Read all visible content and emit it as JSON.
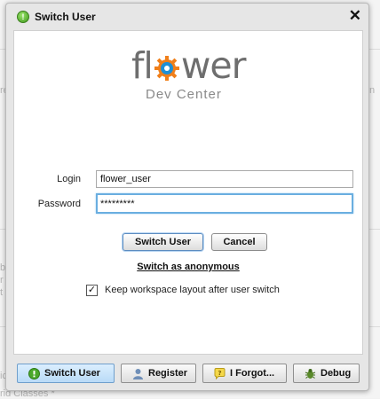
{
  "background": {
    "texts": [
      "re",
      "n",
      "b",
      "r",
      "t",
      "ic",
      "rid Classes *"
    ]
  },
  "dialog": {
    "title": "Switch User",
    "title_icon": "flower-app-icon",
    "close_glyph": "✕"
  },
  "logo": {
    "word": "flower",
    "subtitle": "Dev Center"
  },
  "form": {
    "login_label": "Login",
    "login_value": "flower_user",
    "password_label": "Password",
    "password_value": "*********",
    "switch_button": "Switch User",
    "cancel_button": "Cancel",
    "anonymous_link": "Switch as anonymous",
    "keep_layout_label": "Keep workspace layout after user switch",
    "keep_layout_checked": true
  },
  "footer": {
    "tabs": [
      {
        "label": "Switch User",
        "icon": "switch-user-icon",
        "active": true
      },
      {
        "label": "Register",
        "icon": "user-icon",
        "active": false
      },
      {
        "label": "I Forgot...",
        "icon": "question-bubble-icon",
        "active": false
      },
      {
        "label": "Debug",
        "icon": "bug-icon",
        "active": false
      }
    ]
  },
  "colors": {
    "accent_focus": "#6aaee0",
    "active_tab": "#b9dbf7",
    "logo_orange": "#f07f1a",
    "logo_blue": "#1e8fd6"
  }
}
